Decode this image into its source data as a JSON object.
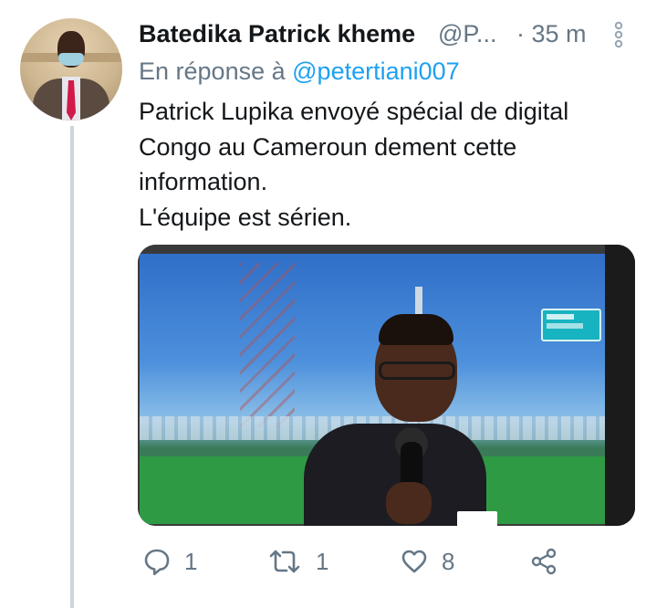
{
  "tweet": {
    "author_name": "Batedika Patrick kheme",
    "author_handle": "@P...",
    "separator": "·",
    "time": "35 m",
    "reply_prefix": "En réponse à",
    "reply_mention": "@petertiani007",
    "text_lines": [
      "Patrick Lupika envoyé spécial de digital",
      "Congo au Cameroun dement cette",
      "information.",
      "L'équipe est sérien."
    ]
  },
  "actions": {
    "reply_count": "1",
    "retweet_count": "1",
    "like_count": "8"
  },
  "icons": {
    "reply": "reply-icon",
    "retweet": "retweet-icon",
    "like": "heart-icon",
    "share": "share-icon",
    "more": "more-vertical-icon"
  },
  "colors": {
    "text": "#14171a",
    "secondary": "#657786",
    "accent": "#1da1f2",
    "thread_line": "#ccd6dd"
  }
}
